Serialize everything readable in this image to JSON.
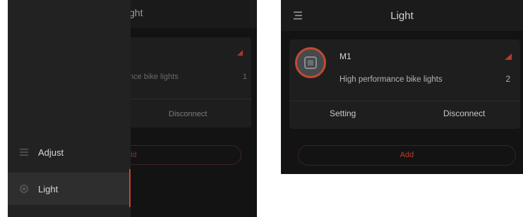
{
  "left_screen": {
    "underlay": {
      "header_title": "ght",
      "device_subtitle": "nce bike lights",
      "device_count": "1",
      "disconnect_label": "Disconnect",
      "add_label": "ld"
    },
    "drawer": {
      "items": [
        {
          "label": "Adjust",
          "icon": "adjust-icon",
          "selected": false
        },
        {
          "label": "Light",
          "icon": "light-icon",
          "selected": true
        }
      ]
    }
  },
  "right_screen": {
    "header": {
      "title": "Light",
      "menu_icon": "menu-icon"
    },
    "device_card": {
      "name": "M1",
      "description": "High performance bike lights",
      "count": "2",
      "signal_icon": "signal-icon",
      "setting_label": "Setting",
      "disconnect_label": "Disconnect"
    },
    "add_label": "Add"
  },
  "colors": {
    "accent": "#c9452f",
    "background": "#131313",
    "card": "#1e1e1e"
  }
}
